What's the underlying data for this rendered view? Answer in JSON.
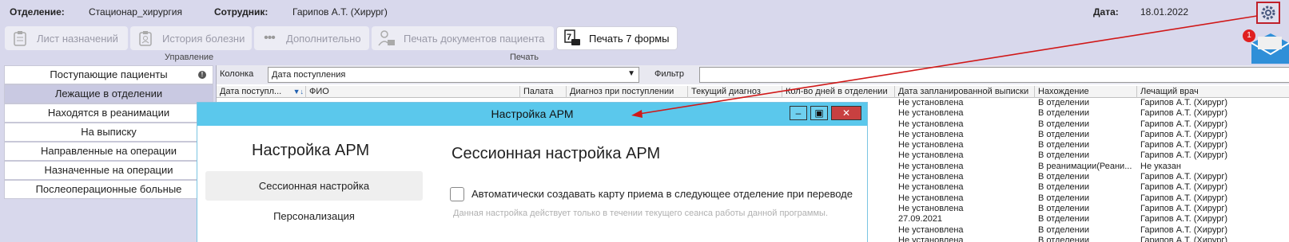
{
  "header": {
    "dept_label": "Отделение:",
    "dept_value": "Стационар_хирургия",
    "emp_label": "Сотрудник:",
    "emp_value": "Гарипов А.Т. (Хирург)",
    "date_label": "Дата:",
    "date_value": "18.01.2022",
    "mail_badge": "1"
  },
  "toolbar": {
    "prescriptions": "Лист назначений",
    "history": "История болезни",
    "more": "Дополнительно",
    "print_docs": "Печать документов пациента",
    "print_form7": "Печать 7 формы",
    "group_manage": "Управление",
    "group_print": "Печать"
  },
  "nav": {
    "items": [
      "Поступающие пациенты",
      "Лежащие в отделении",
      "Находятся в реанимации",
      "На выписку",
      "Направленные на операции",
      "Назначенные на операции",
      "Послеоперационные больные"
    ]
  },
  "filter": {
    "column_label": "Колонка",
    "column_value": "Дата поступления",
    "filter_label": "Фильтр"
  },
  "table": {
    "columns": [
      "Дата поступл...",
      "ФИО",
      "Палата",
      "Диагноз при поступлении",
      "Текущий диагноз",
      "Кол-во дней в отделении",
      "Дата запланированной выписки",
      "Нахождение",
      "Лечащий врач"
    ],
    "rows": [
      [
        "Не установлена",
        "В отделении",
        "Гарипов А.Т. (Хирург)"
      ],
      [
        "Не установлена",
        "В отделении",
        "Гарипов А.Т. (Хирург)"
      ],
      [
        "Не установлена",
        "В отделении",
        "Гарипов А.Т. (Хирург)"
      ],
      [
        "Не установлена",
        "В отделении",
        "Гарипов А.Т. (Хирург)"
      ],
      [
        "Не установлена",
        "В отделении",
        "Гарипов А.Т. (Хирург)"
      ],
      [
        "Не установлена",
        "В отделении",
        "Гарипов А.Т. (Хирург)"
      ],
      [
        "Не установлена",
        "В реанимации(Реани...",
        "Не указан"
      ],
      [
        "Не установлена",
        "В отделении",
        "Гарипов А.Т. (Хирург)"
      ],
      [
        "Не установлена",
        "В отделении",
        "Гарипов А.Т. (Хирург)"
      ],
      [
        "Не установлена",
        "В отделении",
        "Гарипов А.Т. (Хирург)"
      ],
      [
        "Не установлена",
        "В отделении",
        "Гарипов А.Т. (Хирург)"
      ],
      [
        "27.09.2021",
        "В отделении",
        "Гарипов А.Т. (Хирург)"
      ],
      [
        "Не установлена",
        "В отделении",
        "Гарипов А.Т. (Хирург)"
      ],
      [
        "Не установлена",
        "В отделении",
        "Гарипов А.Т. (Хирург)"
      ]
    ]
  },
  "dialog": {
    "title": "Настройка АРМ",
    "heading": "Настройка АРМ",
    "menu": [
      "Сессионная настройка",
      "Персонализация"
    ],
    "section_title": "Сессионная настройка АРМ",
    "checkbox_label": "Автоматически создавать карту приема в следующее отделение при переводе",
    "hint": "Данная настройка действует только в течении текущего сеанса работы данной программы."
  },
  "colors": {
    "accent": "#5bc8ec",
    "selected_nav": "#c9c9e2",
    "arrow": "#d01818"
  }
}
